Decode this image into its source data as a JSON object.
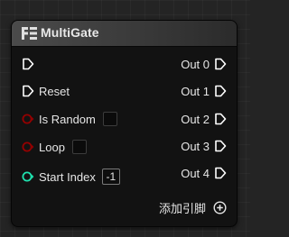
{
  "node": {
    "title": "MultiGate",
    "header_icon": "multigate-flow-icon",
    "inputs": [
      {
        "label": "",
        "pin": "exec",
        "color": "#ffffff"
      },
      {
        "label": "Reset",
        "pin": "exec",
        "color": "#ffffff"
      },
      {
        "label": "Is Random",
        "pin": "bool",
        "color": "#950000",
        "value": false
      },
      {
        "label": "Loop",
        "pin": "bool",
        "color": "#950000",
        "value": false
      },
      {
        "label": "Start Index",
        "pin": "int",
        "color": "#1fe3af",
        "value": "-1"
      }
    ],
    "outputs": [
      {
        "label": "Out 0",
        "pin": "exec"
      },
      {
        "label": "Out 1",
        "pin": "exec"
      },
      {
        "label": "Out 2",
        "pin": "exec"
      },
      {
        "label": "Out 3",
        "pin": "exec"
      },
      {
        "label": "Out 4",
        "pin": "exec"
      }
    ],
    "add_pin": {
      "label": "添加引脚",
      "icon": "add-circle-icon"
    }
  }
}
